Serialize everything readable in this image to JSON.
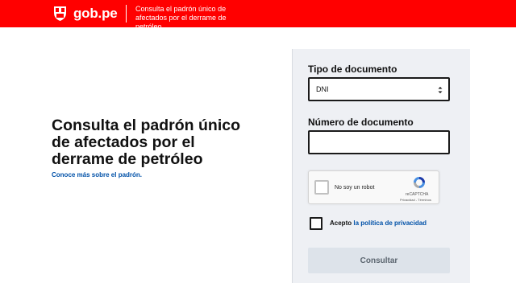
{
  "header": {
    "logo_text": "gob.pe",
    "title": "Consulta el padrón único de afectados por el derrame de petróleo",
    "background_color": "#ff0000"
  },
  "hero": {
    "title": "Consulta el padrón único de afectados por el derrame de petróleo",
    "link": "Conoce más sobre el padrón."
  },
  "form": {
    "document_type_label": "Tipo de documento",
    "document_type_value": "DNI",
    "document_number_label": "Número de documento",
    "document_number_value": "",
    "recaptcha": {
      "label": "No soy un robot",
      "brand": "reCAPTCHA",
      "links": "Privacidad - Términos"
    },
    "accept_prefix": "Acepto",
    "accept_link": "la política de privacidad",
    "submit_label": "Consultar"
  }
}
